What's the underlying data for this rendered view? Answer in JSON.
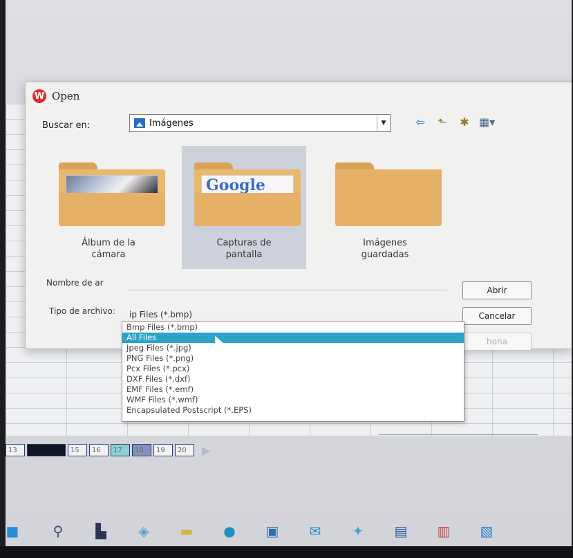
{
  "dialog": {
    "title": "Open",
    "logo_letter": "W",
    "look_in_label": "Buscar en:",
    "look_in_value": "Imágenes",
    "folders": [
      {
        "label_line1": "Álbum de la",
        "label_line2": "cámara",
        "selected": false
      },
      {
        "label_line1": "Capturas de",
        "label_line2": "pantalla",
        "selected": true,
        "thumbnail_text": "Google"
      },
      {
        "label_line1": "Imágenes",
        "label_line2": "guardadas",
        "selected": false
      }
    ],
    "filename_label": "Nombre de ar",
    "filename_value": "",
    "filetype_label": "Tipo de archivo:",
    "filetype_value": "ip Files (*.bmp)",
    "buttons": {
      "open": "Abrir",
      "cancel": "Cancelar",
      "third": "hona"
    },
    "filetype_options": [
      "Bmp Files (*.bmp)",
      "All Files",
      "Jpeg Files (*.jpg)",
      "PNG Files (*.png)",
      "Pcx Files (*.pcx)",
      "DXF Files (*.dxf)",
      "EMF Files (*.emf)",
      "WMF Files (*.wmf)",
      "Encapsulated Postscript (*.EPS)"
    ],
    "selected_option_index": 1
  },
  "sheet_tabs": [
    "13",
    "",
    "15",
    "16",
    "17",
    "18",
    "19",
    "20"
  ],
  "taskbar_icons": [
    "start-icon",
    "search-icon",
    "task-view-icon",
    "widgets-icon",
    "file-explorer-icon",
    "edge-icon",
    "store-icon",
    "mail-icon",
    "photos-icon",
    "word-icon",
    "powerpoint-icon",
    "outlook-icon"
  ],
  "colors": {
    "accent_selection": "#2aa4c7",
    "folder": "#e9b86b",
    "logo": "#d8302b"
  }
}
